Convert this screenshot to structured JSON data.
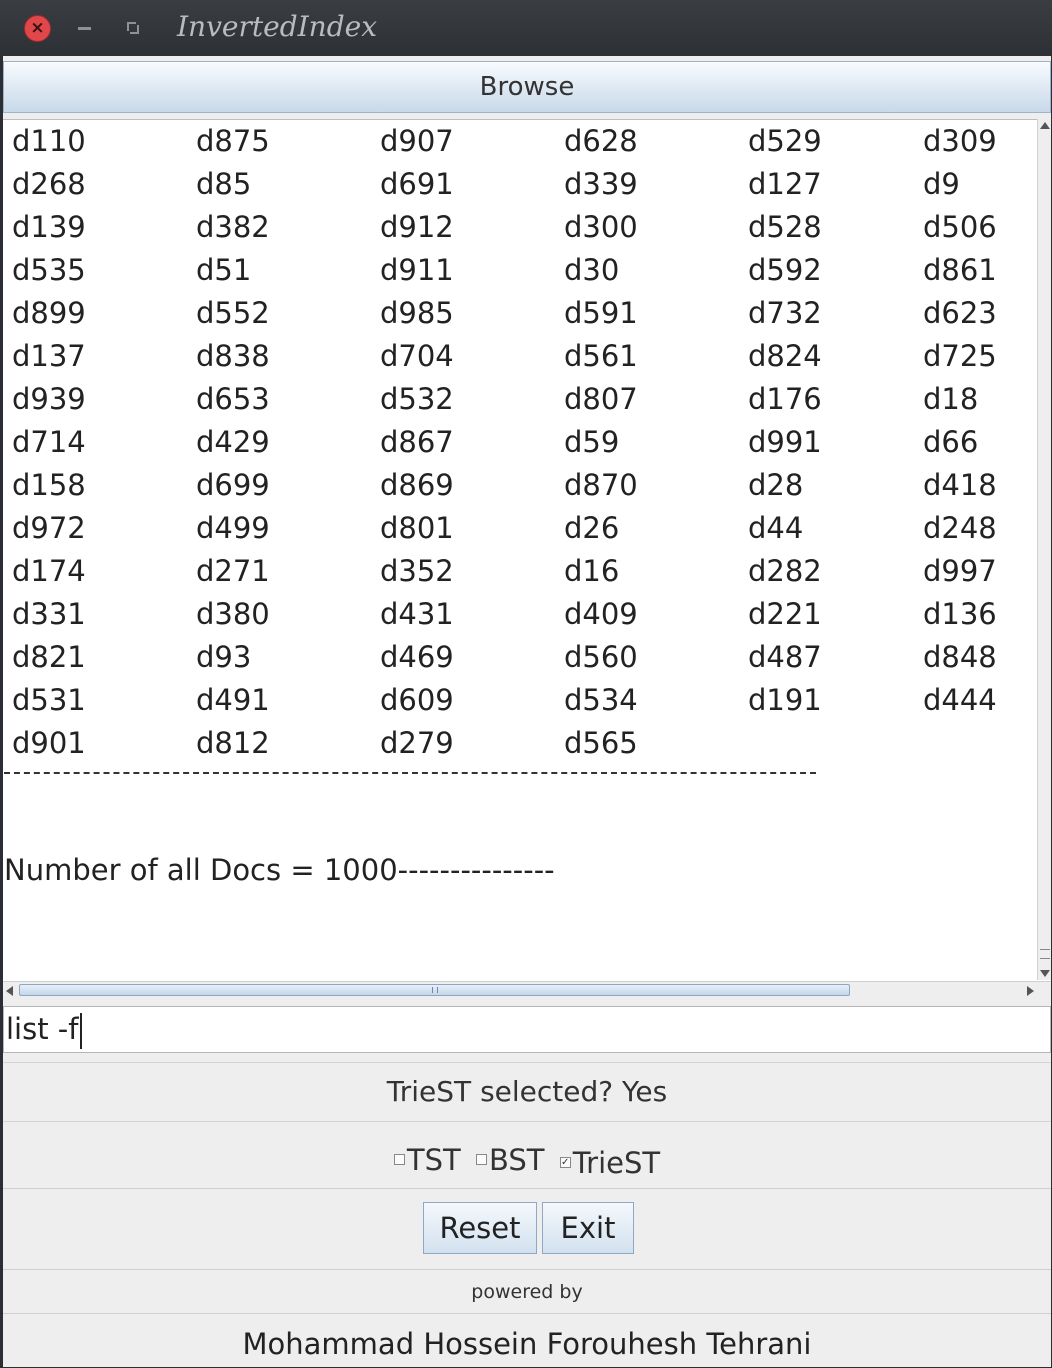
{
  "window": {
    "title": "InvertedIndex"
  },
  "browse_label": "Browse",
  "documents": [
    [
      "d110",
      "d875",
      "d907",
      "d628",
      "d529",
      "d309"
    ],
    [
      "d268",
      "d85",
      "d691",
      "d339",
      "d127",
      "d9"
    ],
    [
      "d139",
      "d382",
      "d912",
      "d300",
      "d528",
      "d506"
    ],
    [
      "d535",
      "d51",
      "d911",
      "d30",
      "d592",
      "d861"
    ],
    [
      "d899",
      "d552",
      "d985",
      "d591",
      "d732",
      "d623"
    ],
    [
      "d137",
      "d838",
      "d704",
      "d561",
      "d824",
      "d725"
    ],
    [
      "d939",
      "d653",
      "d532",
      "d807",
      "d176",
      "d18"
    ],
    [
      "d714",
      "d429",
      "d867",
      "d59",
      "d991",
      "d66"
    ],
    [
      "d158",
      "d699",
      "d869",
      "d870",
      "d28",
      "d418"
    ],
    [
      "d972",
      "d499",
      "d801",
      "d26",
      "d44",
      "d248"
    ],
    [
      "d174",
      "d271",
      "d352",
      "d16",
      "d282",
      "d997"
    ],
    [
      "d331",
      "d380",
      "d431",
      "d409",
      "d221",
      "d136"
    ],
    [
      "d821",
      "d93",
      "d469",
      "d560",
      "d487",
      "d848"
    ],
    [
      "d531",
      "d491",
      "d609",
      "d534",
      "d191",
      "d444"
    ],
    [
      "d901",
      "d812",
      "d279",
      "d565"
    ]
  ],
  "count_text": "Number of all Docs = 1000---------------",
  "command_input": "list -f",
  "status": "TrieST selected? Yes",
  "checkboxes": [
    {
      "label": "TST",
      "checked": false
    },
    {
      "label": "BST",
      "checked": false
    },
    {
      "label": "TrieST",
      "checked": true
    }
  ],
  "buttons": {
    "reset": "Reset",
    "exit": "Exit"
  },
  "powered_by": "powered by",
  "author": "Mohammad Hossein Forouhesh Tehrani"
}
